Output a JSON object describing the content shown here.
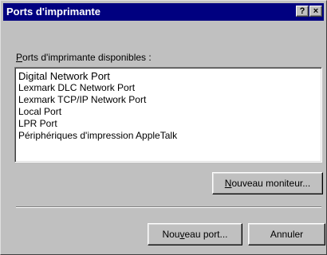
{
  "window": {
    "title": "Ports d'imprimante",
    "help_glyph": "?",
    "close_glyph": "×"
  },
  "ports": {
    "label_mnemonic": "P",
    "label_rest": "orts d'imprimante disponibles :",
    "items": [
      "Digital Network Port",
      "Lexmark DLC Network Port",
      "Lexmark TCP/IP Network Port",
      "Local Port",
      "LPR Port",
      "Périphériques d'impression AppleTalk"
    ]
  },
  "buttons": {
    "new_monitor_mnemonic": "N",
    "new_monitor_rest": "ouveau moniteur...",
    "new_port_pre": "Nou",
    "new_port_mnemonic": "v",
    "new_port_post": "eau port...",
    "cancel": "Annuler"
  },
  "colors": {
    "titlebar": "#000080",
    "dialog_face": "#c0c0c0",
    "list_background": "#ffffff"
  }
}
